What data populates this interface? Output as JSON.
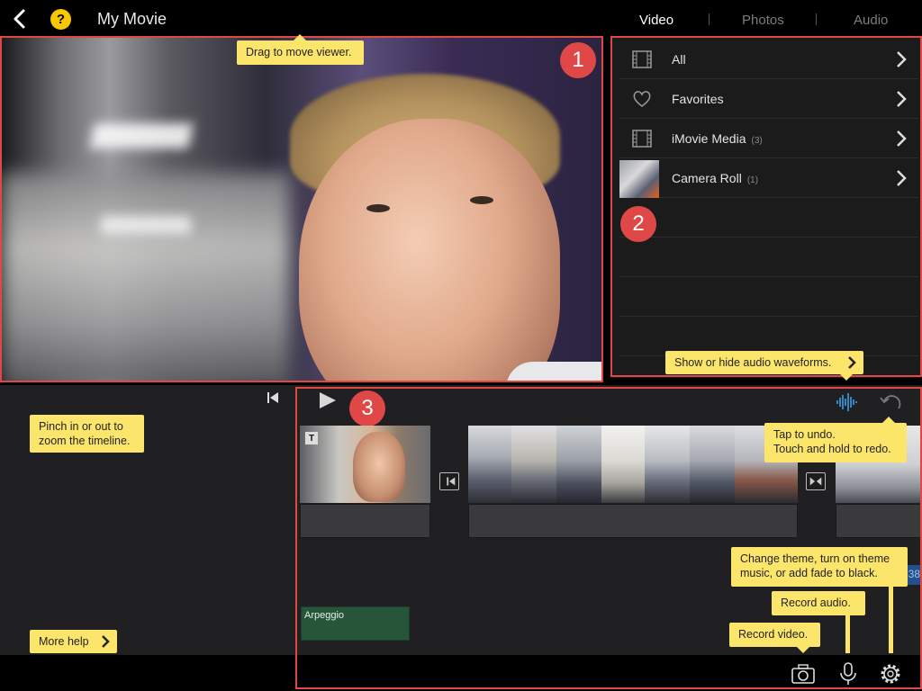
{
  "header": {
    "title": "My Movie",
    "help_symbol": "?",
    "tabs": [
      {
        "label": "Video",
        "active": true
      },
      {
        "label": "Photos",
        "active": false
      },
      {
        "label": "Audio",
        "active": false
      }
    ]
  },
  "viewer": {
    "tip": "Drag to move viewer.",
    "callout": "1"
  },
  "library": {
    "callout": "2",
    "items": [
      {
        "label": "All",
        "count": "",
        "icon": "film-strip-icon"
      },
      {
        "label": "Favorites",
        "count": "",
        "icon": "heart-icon"
      },
      {
        "label": "iMovie Media",
        "count": "(3)",
        "icon": "film-strip-icon"
      },
      {
        "label": "Camera Roll",
        "count": "(1)",
        "icon": "camera-roll-thumbnail"
      }
    ],
    "waveform_tip": "Show or hide audio waveforms."
  },
  "timeline": {
    "callout": "3",
    "pinch_tip_line1": "Pinch in or out to",
    "pinch_tip_line2": "zoom the timeline.",
    "more_help": "More help",
    "undo_tip_line1": "Tap to undo.",
    "undo_tip_line2": "Touch and hold to redo.",
    "audio_clip_label": "Arpeggio",
    "title_marker": "T",
    "clip_time_fragment": ":38"
  },
  "bottom": {
    "theme_tip_line1": "Change theme, turn on theme",
    "theme_tip_line2": "music, or add fade to black.",
    "record_audio_tip": "Record audio.",
    "record_video_tip": "Record video."
  },
  "colors": {
    "accent_red": "#e04848",
    "tooltip_yellow": "#fbe56a",
    "help_yellow": "#f7c800",
    "waveform_blue": "#3aa0e8"
  }
}
